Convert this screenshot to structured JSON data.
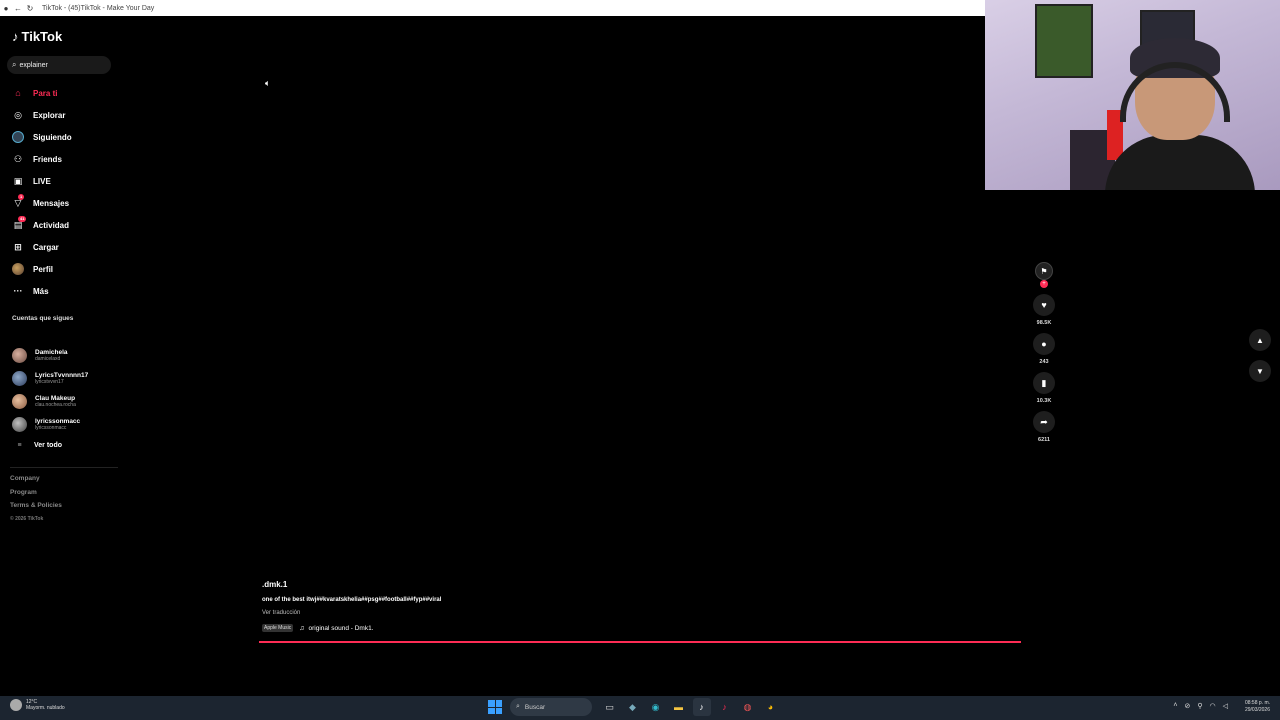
{
  "browser": {
    "title": "TikTok - (45)TikTok - Make Your Day"
  },
  "sidebar": {
    "logo": "TikTok",
    "search_value": "explainer",
    "nav": [
      {
        "label": "Para ti",
        "icon": "home-icon",
        "active": true
      },
      {
        "label": "Explorar",
        "icon": "compass-icon"
      },
      {
        "label": "Siguiendo",
        "icon": "following-avatar-icon"
      },
      {
        "label": "Friends",
        "icon": "friends-icon"
      },
      {
        "label": "LIVE",
        "icon": "live-icon"
      },
      {
        "label": "Mensajes",
        "icon": "messages-icon",
        "badge": "1"
      },
      {
        "label": "Actividad",
        "icon": "activity-icon",
        "badge": "41"
      },
      {
        "label": "Cargar",
        "icon": "upload-icon"
      },
      {
        "label": "Perfil",
        "icon": "profile-avatar-icon"
      },
      {
        "label": "Más",
        "icon": "more-icon"
      }
    ],
    "following_title": "Cuentas que sigues",
    "following": [
      {
        "name": "Damichela",
        "username": "damicelaxd"
      },
      {
        "name": "LyricsTvvnnnn17",
        "username": "lyricstvvvn17"
      },
      {
        "name": "Clau Makeup",
        "username": "clau.nochea.rocha"
      },
      {
        "name": "lyricssonmacc",
        "username": "lyricssonmacc"
      }
    ],
    "see_all": "Ver todo",
    "footer_links": [
      "Company",
      "Program",
      "Terms & Policies"
    ],
    "copyright": "© 2026 TikTok"
  },
  "video": {
    "username": ".dmk.1",
    "description": "one of the best itwj##kvaratskhelia##psg##football##fyp##viral",
    "translate": "Ver traducción",
    "music_tag": "Apple Music",
    "sound": "original sound - Dmk1."
  },
  "actions": {
    "likes": "98.5K",
    "comments": "243",
    "saves": "10.3K",
    "shares": "6211"
  },
  "taskbar": {
    "weather_temp": "12°C",
    "weather_desc": "Mayorm. nublado",
    "search_label": "Buscar",
    "time": "08:58 p. m.",
    "date": "29/03/2026"
  },
  "colors": {
    "accent": "#fe2c55",
    "background": "#000000",
    "taskbar": "#1c2530"
  }
}
